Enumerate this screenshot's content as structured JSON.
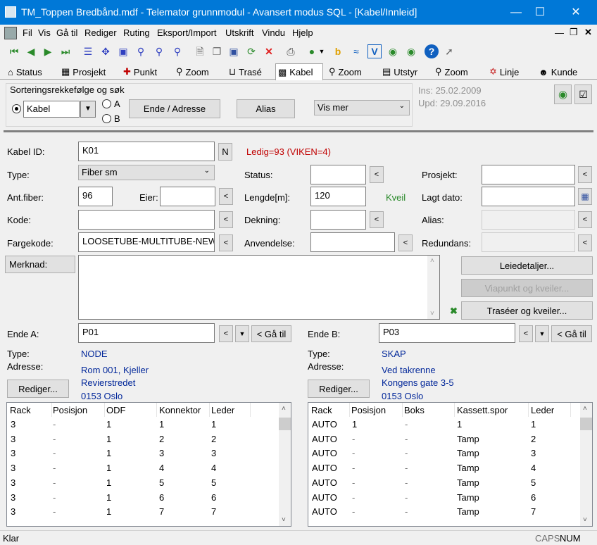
{
  "window": {
    "title": "TM_Toppen Bredbånd.mdf - Telemator grunnmodul - Avansert modus SQL - [Kabel/Innleid]"
  },
  "menu": [
    "Fil",
    "Vis",
    "Gå til",
    "Rediger",
    "Ruting",
    "Eksport/Import",
    "Utskrift",
    "Vindu",
    "Hjelp"
  ],
  "tabs": [
    {
      "label": "Status",
      "icon": "home-icon"
    },
    {
      "label": "Prosjekt",
      "icon": "project-icon"
    },
    {
      "label": "Punkt",
      "icon": "point-icon"
    },
    {
      "label": "Zoom",
      "icon": "zoom-icon"
    },
    {
      "label": "Trasé",
      "icon": "route-icon"
    },
    {
      "label": "Kabel",
      "icon": "cable-icon"
    },
    {
      "label": "Zoom",
      "icon": "zoom-icon"
    },
    {
      "label": "Utstyr",
      "icon": "equipment-icon"
    },
    {
      "label": "Zoom",
      "icon": "zoom-icon"
    },
    {
      "label": "Linje",
      "icon": "line-icon"
    },
    {
      "label": "Kunde",
      "icon": "customer-icon"
    }
  ],
  "sort": {
    "group_label": "Sorteringsrekkefølge og søk",
    "selected": "Kabel",
    "radio_a": "A",
    "radio_b": "B",
    "ende_button": "Ende / Adresse",
    "alias_button": "Alias",
    "vis_mer": "Vis mer",
    "ins": "Ins: 25.02.2009",
    "upd": "Upd: 29.09.2016"
  },
  "form": {
    "kabel_id_label": "Kabel ID:",
    "kabel_id": "K01",
    "n_button": "N",
    "ledig": "Ledig=93 (VIKEN=4)",
    "type_label": "Type:",
    "type": "Fiber sm",
    "status_label": "Status:",
    "status": "",
    "prosjekt_label": "Prosjekt:",
    "prosjekt": "",
    "antfiber_label": "Ant.fiber:",
    "antfiber": "96",
    "eier_label": "Eier:",
    "eier": "",
    "lengde_label": "Lengde[m]:",
    "lengde": "120",
    "kveil": "Kveil",
    "lagt_dato_label": "Lagt dato:",
    "lagt_dato": "",
    "kode_label": "Kode:",
    "kode": "",
    "dekning_label": "Dekning:",
    "dekning": "",
    "alias_label": "Alias:",
    "alias": "",
    "fargekode_label": "Fargekode:",
    "fargekode": "LOOSETUBE-MULTITUBE-NEW",
    "anvendelse_label": "Anvendelse:",
    "anvendelse": "",
    "redundans_label": "Redundans:",
    "redundans": "",
    "merknad_button": "Merknad:",
    "merknad": "",
    "leiedetaljer_button": "Leiedetaljer...",
    "viapunkt_button": "Viapunkt og kveiler...",
    "traseer_button": "Traséer og kveiler..."
  },
  "ende_a": {
    "label": "Ende A:",
    "value": "P01",
    "goto": "< Gå til",
    "type_label": "Type:",
    "type": "NODE",
    "adresse_label": "Adresse:",
    "adresse": [
      "Rom 001, Kjeller",
      "Revierstredet",
      "0153 Oslo"
    ],
    "rediger": "Rediger...",
    "columns": [
      "Rack",
      "Posisjon",
      "ODF",
      "Konnektor",
      "Leder"
    ],
    "rows": [
      [
        "3",
        "-",
        "1",
        "1",
        "1"
      ],
      [
        "3",
        "-",
        "1",
        "2",
        "2"
      ],
      [
        "3",
        "-",
        "1",
        "3",
        "3"
      ],
      [
        "3",
        "-",
        "1",
        "4",
        "4"
      ],
      [
        "3",
        "-",
        "1",
        "5",
        "5"
      ],
      [
        "3",
        "-",
        "1",
        "6",
        "6"
      ],
      [
        "3",
        "-",
        "1",
        "7",
        "7"
      ]
    ]
  },
  "ende_b": {
    "label": "Ende B:",
    "value": "P03",
    "goto": "< Gå til",
    "type_label": "Type:",
    "type": "SKAP",
    "adresse_label": "Adresse:",
    "adresse": [
      "Ved takrenne",
      "Kongens gate 3-5",
      "0153 Oslo"
    ],
    "rediger": "Rediger...",
    "columns": [
      "Rack",
      "Posisjon",
      "Boks",
      "Kassett.spor",
      "Leder"
    ],
    "rows": [
      [
        "AUTO",
        "1",
        "-",
        "1",
        "1"
      ],
      [
        "AUTO",
        "-",
        "-",
        "Tamp",
        "2"
      ],
      [
        "AUTO",
        "-",
        "-",
        "Tamp",
        "3"
      ],
      [
        "AUTO",
        "-",
        "-",
        "Tamp",
        "4"
      ],
      [
        "AUTO",
        "-",
        "-",
        "Tamp",
        "5"
      ],
      [
        "AUTO",
        "-",
        "-",
        "Tamp",
        "6"
      ],
      [
        "AUTO",
        "-",
        "-",
        "Tamp",
        "7"
      ]
    ]
  },
  "status": {
    "text": "Klar",
    "caps": "CAPS",
    "num": "NUM"
  },
  "colors": {
    "title": "#0078d7",
    "ledig": "#c00000",
    "info": "#002699"
  }
}
